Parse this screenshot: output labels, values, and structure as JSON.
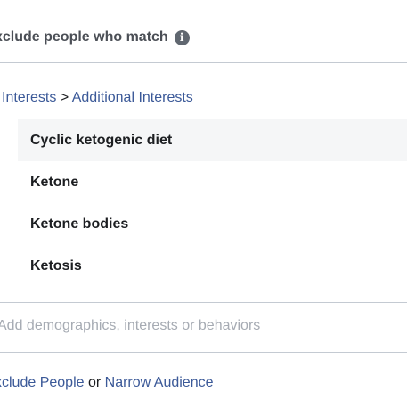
{
  "header": {
    "title": "xclude people who match",
    "info_icon": "info-icon"
  },
  "breadcrumb": {
    "category": "Interests",
    "separator": ">",
    "subcategory": "Additional Interests"
  },
  "interests": [
    {
      "label": "Cyclic ketogenic diet",
      "highlighted": true
    },
    {
      "label": "Ketone",
      "highlighted": false
    },
    {
      "label": "Ketone bodies",
      "highlighted": false
    },
    {
      "label": "Ketosis",
      "highlighted": false
    }
  ],
  "search": {
    "placeholder": "Add demographics, interests or behaviors"
  },
  "footer": {
    "exclude_link": "xclude People",
    "connector": " or ",
    "narrow_link": "Narrow Audience"
  },
  "colors": {
    "link": "#3b5998",
    "text": "#1c1e21",
    "placeholder": "#a6abb3",
    "highlight_bg": "#f5f6f7"
  }
}
